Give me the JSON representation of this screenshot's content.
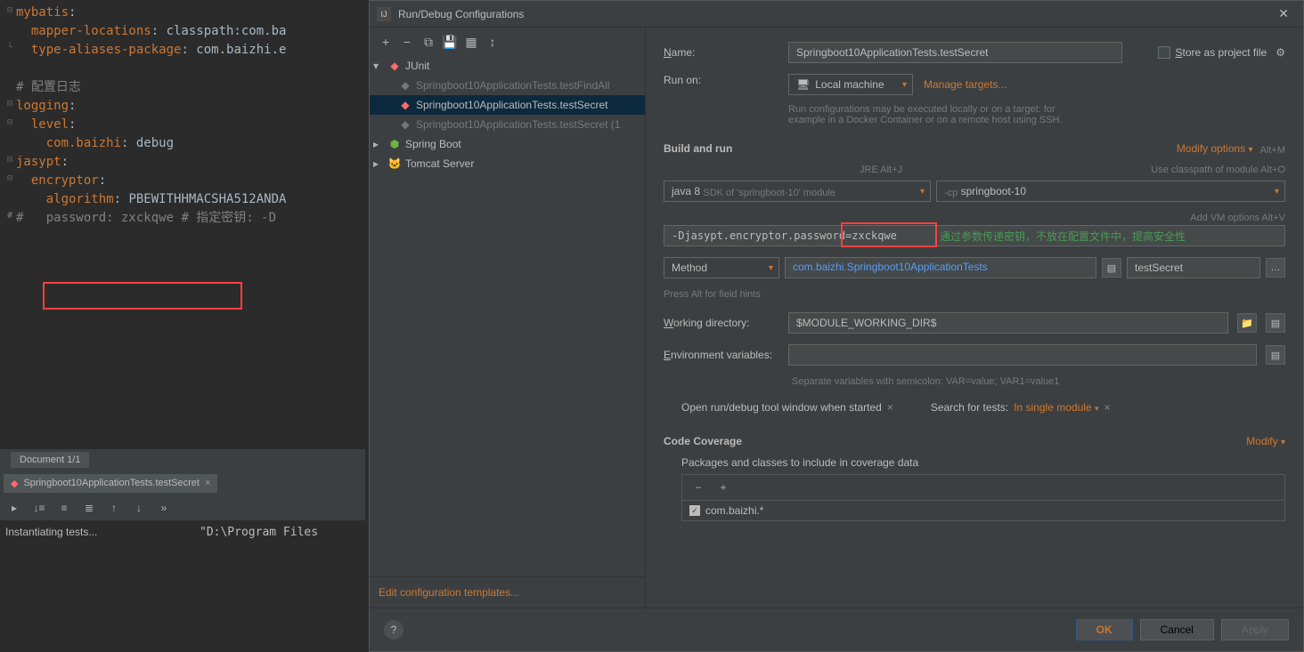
{
  "editor": {
    "l1a": "mybatis",
    "l1b": ":",
    "l2a": "  mapper-locations",
    "l2b": ": ",
    "l2c": "classpath:com.ba",
    "l3a": "  type-aliases-package",
    "l3b": ": ",
    "l3c": "com.baizhi.e",
    "l5": "# 配置日志",
    "l6a": "logging",
    "l6b": ":",
    "l7a": "  level",
    "l7b": ":",
    "l8a": "    com.baizhi",
    "l8b": ": ",
    "l8c": "debug",
    "l9a": "jasypt",
    "l9b": ":",
    "l10a": "  encryptor",
    "l10b": ":",
    "l11a": "    algorithm",
    "l11b": ": ",
    "l11c": "PBEWITHHMACSHA512ANDA",
    "l12a": "#   password: zxckqwe ",
    "l12b": "# 指定密钥: -D"
  },
  "status": {
    "doc": "Document 1/1"
  },
  "tab": {
    "name": "Springboot10ApplicationTests.testSecret"
  },
  "console": {
    "left": "Instantiating tests...",
    "right": "\"D:\\Program Files"
  },
  "dialog": {
    "title": "Run/Debug Configurations",
    "name_label": "Name:",
    "name_value": "Springboot10ApplicationTests.testSecret",
    "store_label": "Store as project file",
    "runon_label": "Run on:",
    "runon_value": "Local machine",
    "manage": "Manage targets...",
    "runon_hint1": "Run configurations may be executed locally or on a target: for",
    "runon_hint2": "example in a Docker Container or on a remote host using SSH.",
    "build_header": "Build and run",
    "modify_opts": "Modify options",
    "jre_hint": "JRE Alt+J",
    "classpath_hint": "Use classpath of module Alt+O",
    "addvm_hint": "Add VM options Alt+V",
    "altm": "Alt+M",
    "java_sel": "java 8",
    "java_sdk": "SDK of 'springboot-10' module",
    "cp_label": "-cp",
    "cp_value": "springboot-10",
    "vm_opts": "-Djasypt.encryptor.password=",
    "vm_val": "zxckqwe",
    "green_annot": "通过参数传递密钥，不放在配置文件中，提高安全性",
    "method": "Method",
    "test_class": "com.baizhi.Springboot10ApplicationTests",
    "test_method": "testSecret",
    "alt_hint": "Press Alt for field hints",
    "wd_label": "Working directory:",
    "wd_value": "$MODULE_WORKING_DIR$",
    "env_label": "Environment variables:",
    "env_hint": "Separate variables with semicolon: VAR=value; VAR1=value1",
    "open_tool": "Open run/debug tool window when started",
    "search_label": "Search for tests:",
    "search_value": "In single module",
    "coverage_header": "Code Coverage",
    "modify": "Modify",
    "pkg_label": "Packages and classes to include in coverage data",
    "pkg_entry": "com.baizhi.*",
    "edit_templates": "Edit configuration templates...",
    "ok": "OK",
    "cancel": "Cancel",
    "apply": "Apply"
  },
  "tree": {
    "junit": "JUnit",
    "t1": "Springboot10ApplicationTests.testFindAll",
    "t2": "Springboot10ApplicationTests.testSecret",
    "t3": "Springboot10ApplicationTests.testSecret (1",
    "spring": "Spring Boot",
    "tomcat": "Tomcat Server"
  }
}
